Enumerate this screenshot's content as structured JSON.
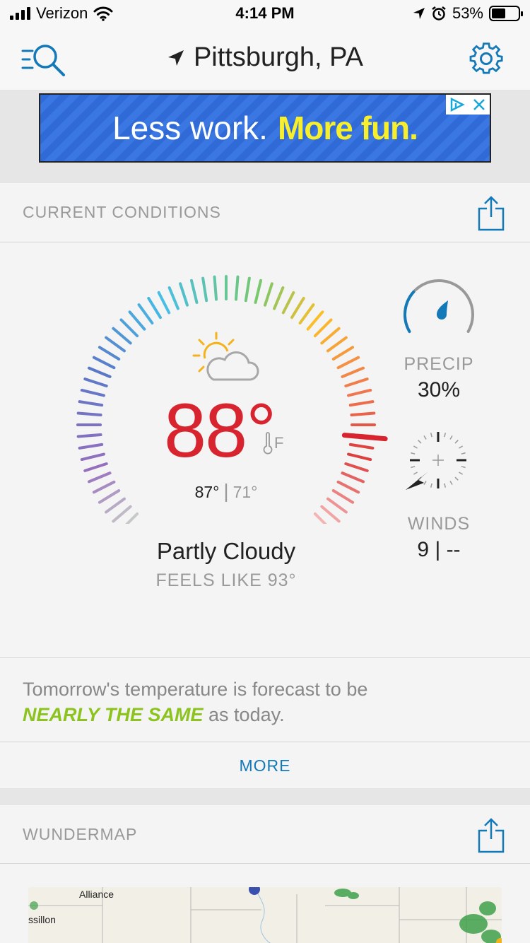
{
  "status_bar": {
    "carrier": "Verizon",
    "time": "4:14 PM",
    "battery_percent": "53%",
    "battery_level": 0.53
  },
  "nav": {
    "location": "Pittsburgh, PA"
  },
  "ad": {
    "text_plain": "Less work.",
    "text_strong": "More fun."
  },
  "current_conditions": {
    "header": "CURRENT CONDITIONS",
    "temperature": "88°",
    "unit": "F",
    "high": "87°",
    "low": "71°",
    "condition": "Partly Cloudy",
    "feels_like": "FEELS LIKE 93°",
    "precip_label": "PRECIP",
    "precip_value": "30%",
    "precip_level": 0.3,
    "winds_label": "WINDS",
    "winds_value": "9 | --"
  },
  "forecast": {
    "line1": "Tomorrow's temperature is forecast to be",
    "highlight": "NEARLY THE SAME",
    "line2_rest": " as today."
  },
  "more_label": "MORE",
  "wundermap": {
    "header": "WUNDERMAP",
    "places": [
      "Alliance",
      "ssillon"
    ]
  },
  "colors": {
    "accent": "#1479b8",
    "temp": "#d7242e",
    "highlight": "#8cc31e"
  }
}
